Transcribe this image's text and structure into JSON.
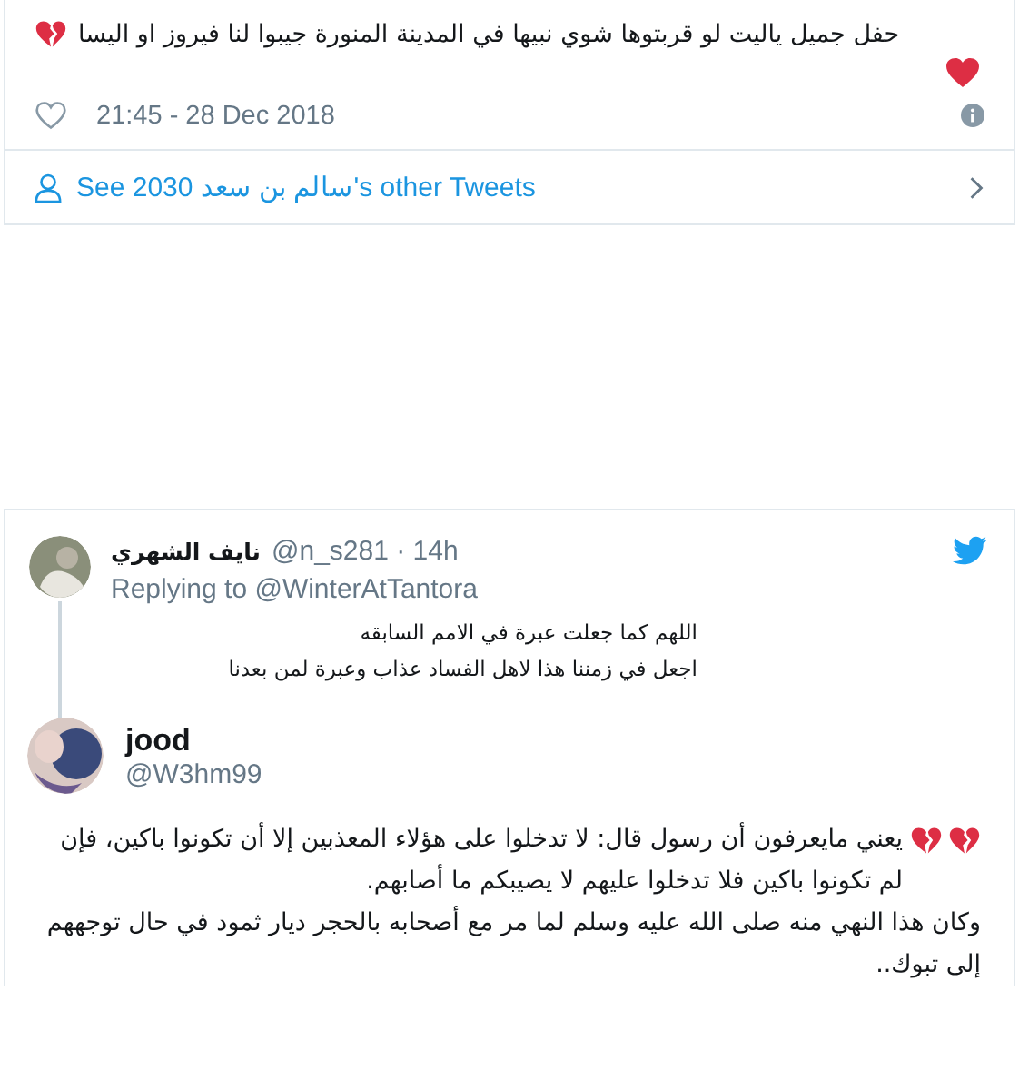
{
  "tweet": {
    "text": "حفل جميل ياليت لو قربتوها شوي نبيها في المدينة المنورة جيبوا لنا فيروز او اليسا",
    "time": "21:45 - 28 Dec 2018",
    "liked": false,
    "more_link": "See 2030 سالم بن سعد's other Tweets"
  },
  "reply": {
    "name": "نايف الشهري",
    "handle": "@n_s281",
    "time": "· 14h",
    "replying_to": "Replying to @WinterAtTantora",
    "lines": [
      "اللهم كما جعلت عبرة  في الامم السابقه",
      "اجعل في زمننا هذا لاهل الفساد عذاب وعبرة لمن بعدنا"
    ]
  },
  "quoted": {
    "name": "jood",
    "handle": "@W3hm99",
    "paragraphs": [
      "يعني مايعرفون أن رسول  قال: لا تدخلوا على هؤلاء المعذبين إلا أن تكونوا باكين، فإن لم تكونوا باكين فلا تدخلوا عليهم لا يصيبكم ما أصابهم.",
      "وكان هذا النهي منه صلى الله عليه وسلم لما مر مع أصحابه بالحجر ديار ثمود في حال توجههم إلى تبوك.."
    ]
  }
}
